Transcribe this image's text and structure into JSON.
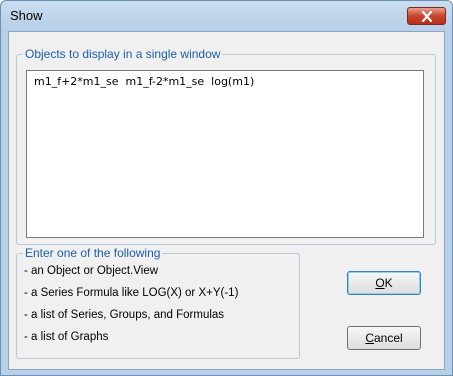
{
  "window": {
    "title": "Show"
  },
  "objects_group": {
    "legend": "Objects to display in a single window",
    "value": "m1_f+2*m1_se  m1_f-2*m1_se  log(m1)"
  },
  "hint_group": {
    "legend": "Enter one of the following",
    "items": [
      "- an Object or Object.View",
      "- a Series Formula like LOG(X) or X+Y(-1)",
      "- a list of Series, Groups, and Formulas",
      "- a list of Graphs"
    ]
  },
  "buttons": {
    "ok_mnemonic": "O",
    "ok_rest": "K",
    "cancel_mnemonic": "C",
    "cancel_rest": "ancel"
  },
  "icons": {
    "close": "close-icon"
  }
}
